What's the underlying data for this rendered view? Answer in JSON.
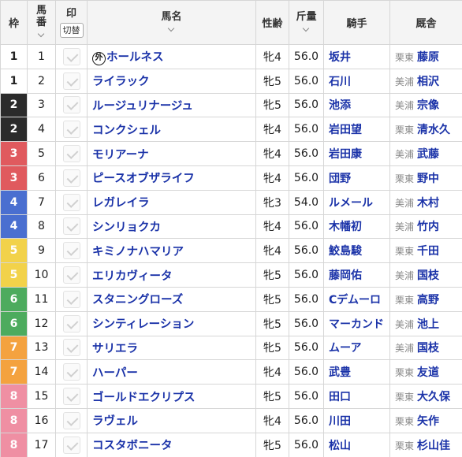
{
  "header": {
    "waku": "枠",
    "umaban_line1": "馬",
    "umaban_line2": "番",
    "mark": "印",
    "kirikae": "切替",
    "horse": "馬名",
    "sexage": "性齢",
    "weight": "斤量",
    "jockey": "騎手",
    "trainer": "厩舎"
  },
  "waku_colors": {
    "1": {
      "bg": "#ffffff",
      "fg": "#222222"
    },
    "2": {
      "bg": "#2b2b2b",
      "fg": "#ffffff"
    },
    "3": {
      "bg": "#e05a5e",
      "fg": "#ffffff"
    },
    "4": {
      "bg": "#4a6fd0",
      "fg": "#ffffff"
    },
    "5": {
      "bg": "#f2d24a",
      "fg": "#ffffff"
    },
    "6": {
      "bg": "#4dab5e",
      "fg": "#ffffff"
    },
    "7": {
      "bg": "#f4a23f",
      "fg": "#ffffff"
    },
    "8": {
      "bg": "#ef8fa3",
      "fg": "#ffffff"
    }
  },
  "rows": [
    {
      "waku": "1",
      "num": "1",
      "gai": "外",
      "horse": "ホールネス",
      "sexage": "牝4",
      "weight": "56.0",
      "jockey": "坂井",
      "region": "栗東",
      "trainer": "藤原"
    },
    {
      "waku": "1",
      "num": "2",
      "gai": "",
      "horse": "ライラック",
      "sexage": "牝5",
      "weight": "56.0",
      "jockey": "石川",
      "region": "美浦",
      "trainer": "相沢"
    },
    {
      "waku": "2",
      "num": "3",
      "gai": "",
      "horse": "ルージュリナージュ",
      "sexage": "牝5",
      "weight": "56.0",
      "jockey": "池添",
      "region": "美浦",
      "trainer": "宗像"
    },
    {
      "waku": "2",
      "num": "4",
      "gai": "",
      "horse": "コンクシェル",
      "sexage": "牝4",
      "weight": "56.0",
      "jockey": "岩田望",
      "region": "栗東",
      "trainer": "清水久"
    },
    {
      "waku": "3",
      "num": "5",
      "gai": "",
      "horse": "モリアーナ",
      "sexage": "牝4",
      "weight": "56.0",
      "jockey": "岩田康",
      "region": "美浦",
      "trainer": "武藤"
    },
    {
      "waku": "3",
      "num": "6",
      "gai": "",
      "horse": "ピースオブザライフ",
      "sexage": "牝4",
      "weight": "56.0",
      "jockey": "団野",
      "region": "栗東",
      "trainer": "野中"
    },
    {
      "waku": "4",
      "num": "7",
      "gai": "",
      "horse": "レガレイラ",
      "sexage": "牝3",
      "weight": "54.0",
      "jockey": "ルメール",
      "region": "美浦",
      "trainer": "木村"
    },
    {
      "waku": "4",
      "num": "8",
      "gai": "",
      "horse": "シンリョクカ",
      "sexage": "牝4",
      "weight": "56.0",
      "jockey": "木幡初",
      "region": "美浦",
      "trainer": "竹内"
    },
    {
      "waku": "5",
      "num": "9",
      "gai": "",
      "horse": "キミノナハマリア",
      "sexage": "牝4",
      "weight": "56.0",
      "jockey": "鮫島駿",
      "region": "栗東",
      "trainer": "千田"
    },
    {
      "waku": "5",
      "num": "10",
      "gai": "",
      "horse": "エリカヴィータ",
      "sexage": "牝5",
      "weight": "56.0",
      "jockey": "藤岡佑",
      "region": "美浦",
      "trainer": "国枝"
    },
    {
      "waku": "6",
      "num": "11",
      "gai": "",
      "horse": "スタニングローズ",
      "sexage": "牝5",
      "weight": "56.0",
      "jockey": "Cデムーロ",
      "region": "栗東",
      "trainer": "高野"
    },
    {
      "waku": "6",
      "num": "12",
      "gai": "",
      "horse": "シンティレーション",
      "sexage": "牝5",
      "weight": "56.0",
      "jockey": "マーカンド",
      "region": "美浦",
      "trainer": "池上"
    },
    {
      "waku": "7",
      "num": "13",
      "gai": "",
      "horse": "サリエラ",
      "sexage": "牝5",
      "weight": "56.0",
      "jockey": "ムーア",
      "region": "美浦",
      "trainer": "国枝"
    },
    {
      "waku": "7",
      "num": "14",
      "gai": "",
      "horse": "ハーパー",
      "sexage": "牝4",
      "weight": "56.0",
      "jockey": "武豊",
      "region": "栗東",
      "trainer": "友道"
    },
    {
      "waku": "8",
      "num": "15",
      "gai": "",
      "horse": "ゴールドエクリプス",
      "sexage": "牝5",
      "weight": "56.0",
      "jockey": "田口",
      "region": "栗東",
      "trainer": "大久保"
    },
    {
      "waku": "8",
      "num": "16",
      "gai": "",
      "horse": "ラヴェル",
      "sexage": "牝4",
      "weight": "56.0",
      "jockey": "川田",
      "region": "栗東",
      "trainer": "矢作"
    },
    {
      "waku": "8",
      "num": "17",
      "gai": "",
      "horse": "コスタボニータ",
      "sexage": "牝5",
      "weight": "56.0",
      "jockey": "松山",
      "region": "栗東",
      "trainer": "杉山佳"
    }
  ]
}
